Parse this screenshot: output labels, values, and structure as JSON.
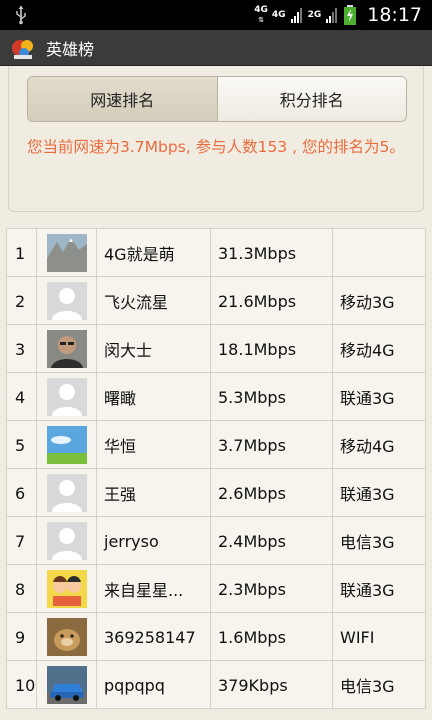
{
  "status_bar": {
    "network_1": "4G",
    "network_2": "4G",
    "network_3": "2G",
    "time": "18:17"
  },
  "title_bar": {
    "title": "英雄榜"
  },
  "tabs": [
    {
      "label": "网速排名",
      "active": true
    },
    {
      "label": "积分排名",
      "active": false
    }
  ],
  "info_text": "您当前网速为3.7Mbps, 参与人数153 , 您的排名为5。",
  "ranking": [
    {
      "rank": "1",
      "avatar": "landscape",
      "name": "4G就是萌",
      "speed": "31.3Mbps",
      "network": ""
    },
    {
      "rank": "2",
      "avatar": "default",
      "name": "飞火流星",
      "speed": "21.6Mbps",
      "network": "移动3G"
    },
    {
      "rank": "3",
      "avatar": "photo",
      "name": "闵大士",
      "speed": "18.1Mbps",
      "network": "移动4G"
    },
    {
      "rank": "4",
      "avatar": "default",
      "name": "曙瞰",
      "speed": "5.3Mbps",
      "network": "联通3G"
    },
    {
      "rank": "5",
      "avatar": "sky",
      "name": "华恒",
      "speed": "3.7Mbps",
      "network": "移动4G"
    },
    {
      "rank": "6",
      "avatar": "default",
      "name": "王强",
      "speed": "2.6Mbps",
      "network": "联通3G"
    },
    {
      "rank": "7",
      "avatar": "default",
      "name": "jerryso",
      "speed": "2.4Mbps",
      "network": "电信3G"
    },
    {
      "rank": "8",
      "avatar": "cartoon",
      "name": "来自星星...",
      "speed": "2.3Mbps",
      "network": "联通3G"
    },
    {
      "rank": "9",
      "avatar": "animal",
      "name": "369258147",
      "speed": "1.6Mbps",
      "network": "WIFI"
    },
    {
      "rank": "10",
      "avatar": "car",
      "name": "pqpqpq",
      "speed": "379Kbps",
      "network": "电信3G"
    }
  ],
  "colors": {
    "info_text": "#ea6b3d",
    "background": "#f1ece1",
    "title_bar": "#3b3b3b"
  }
}
